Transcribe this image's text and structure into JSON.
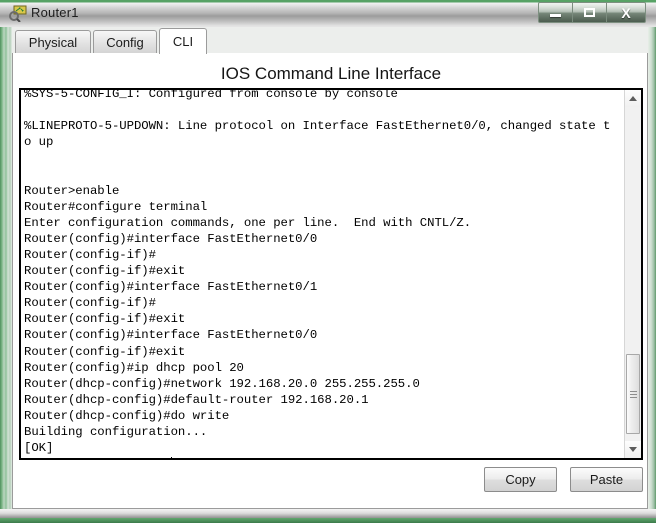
{
  "window": {
    "title": "Router1",
    "icon": "router-device-icon",
    "controls": {
      "minimize_label": "Minimize",
      "maximize_label": "Maximize",
      "close_label": "X"
    }
  },
  "tabs": [
    {
      "label": "Physical",
      "active": false
    },
    {
      "label": "Config",
      "active": false
    },
    {
      "label": "CLI",
      "active": true
    }
  ],
  "panel": {
    "title": "IOS Command Line Interface"
  },
  "terminal": {
    "lines": [
      "%SYS-5-CONFIG_I: Configured from console by console",
      "",
      "%LINEPROTO-5-UPDOWN: Line protocol on Interface FastEthernet0/0, changed state t",
      "o up",
      "",
      "",
      "Router>enable",
      "Router#configure terminal",
      "Enter configuration commands, one per line.  End with CNTL/Z.",
      "Router(config)#interface FastEthernet0/0",
      "Router(config-if)#",
      "Router(config-if)#exit",
      "Router(config)#interface FastEthernet0/1",
      "Router(config-if)#",
      "Router(config-if)#exit",
      "Router(config)#interface FastEthernet0/0",
      "Router(config-if)#exit",
      "Router(config)#ip dhcp pool 20",
      "Router(dhcp-config)#network 192.168.20.0 255.255.255.0",
      "Router(dhcp-config)#default-router 192.168.20.1",
      "Router(dhcp-config)#do write",
      "Building configuration...",
      "[OK]"
    ],
    "prompt_line": "Router(dhcp-config)#",
    "scrollbar": {
      "up_icon": "scroll-up-arrow-icon",
      "down_icon": "scroll-down-arrow-icon",
      "thumb_position_percent": 76
    }
  },
  "footer": {
    "copy_label": "Copy",
    "paste_label": "Paste"
  },
  "colors": {
    "frame_green": "#4e8f5c",
    "titlebar_gray": "#b6b6b6",
    "terminal_bg": "#ffffff",
    "terminal_text": "#000000",
    "tab_active_bg": "#ffffff"
  }
}
